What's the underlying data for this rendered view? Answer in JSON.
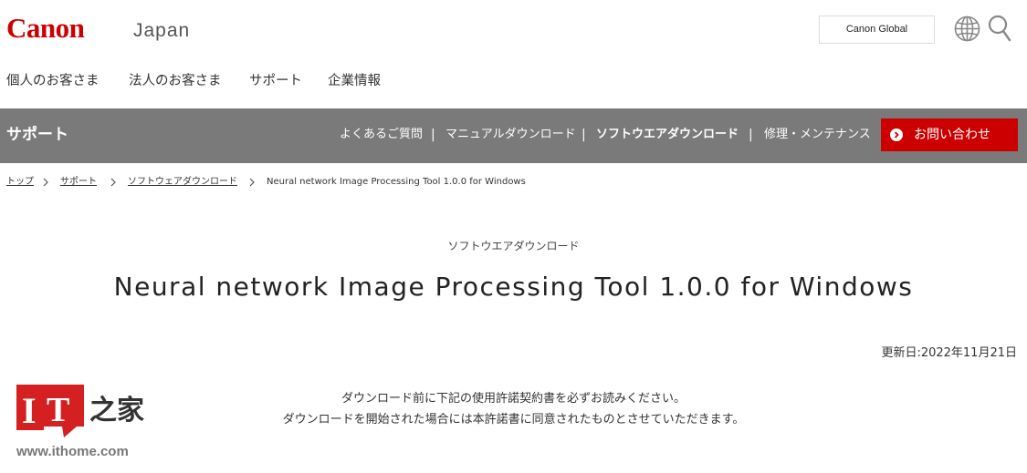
{
  "header": {
    "logo_text": "Canon",
    "region": "Japan",
    "global_button": "Canon Global",
    "icons": [
      "globe-icon",
      "search-icon"
    ]
  },
  "main_nav": [
    "個人のお客さま",
    "法人のお客さま",
    "サポート",
    "企業情報"
  ],
  "support_bar": {
    "title": "サポート",
    "links": [
      "よくあるご質問",
      "マニュアルダウンロード",
      "ソフトウエアダウンロード",
      "修理・メンテナンス"
    ],
    "active_link": "ソフトウエアダウンロード",
    "separator": "|",
    "contact_button": "お問い合わせ",
    "background_color": "#7a7a7a",
    "accent_color": "#cc0000"
  },
  "breadcrumb": [
    "トップ",
    "サポート",
    "ソフトウェアダウンロード",
    "Neural network Image Processing Tool 1.0.0 for Windows"
  ],
  "content": {
    "category": "ソフトウエアダウンロード",
    "title": "Neural network Image Processing Tool 1.0.0 for Windows",
    "updated": "更新日:2022年11月21日",
    "notice_line1": "ダウンロード前に下記の使用許諾契約書を必ずお読みください。",
    "notice_line2": "ダウンロードを開始された場合には本許諾書に同意されたものとさせていただきます。"
  },
  "watermark": {
    "logo_text": "IT之家",
    "url": "www.ithome.com"
  }
}
